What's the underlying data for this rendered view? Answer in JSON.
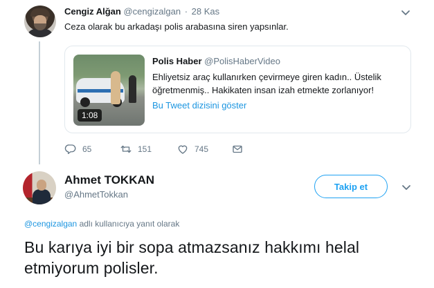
{
  "parent_tweet": {
    "author_name": "Cengiz Alğan",
    "author_handle": "@cengizalgan",
    "separator": "·",
    "time": "28 Kas",
    "text": "Ceza olarak bu arkadaşı polis arabasına siren yapsınlar.",
    "quoted": {
      "author_name": "Polis Haber",
      "author_handle": "@PolisHaberVideo",
      "text": "Ehliyetsiz araç kullanırken çevirmeye giren kadın.. Üstelik öğretmenmiş.. Hakikaten insan izah etmekte zorlanıyor!",
      "link_text": "Bu Tweet dizisini göster",
      "video_duration": "1:08"
    },
    "actions": {
      "reply_icon": "reply-icon",
      "reply_count": "65",
      "retweet_icon": "retweet-icon",
      "retweet_count": "151",
      "like_icon": "heart-icon",
      "like_count": "745",
      "dm_icon": "envelope-icon"
    }
  },
  "reply_tweet": {
    "author_name": "Ahmet TOKKAN",
    "author_handle": "@AhmetTokkan",
    "follow_label": "Takip et",
    "reply_to_mention": "@cengizalgan",
    "reply_to_suffix": " adlı kullanıcıya yanıt olarak",
    "text": "Bu karıya iyi bir sopa atmazsanız hakkımı helal etmiyorum polisler."
  },
  "colors": {
    "accent": "#1da1f2",
    "link": "#1b95e0",
    "muted": "#657786",
    "text": "#14171a",
    "border": "#e1e8ed"
  }
}
